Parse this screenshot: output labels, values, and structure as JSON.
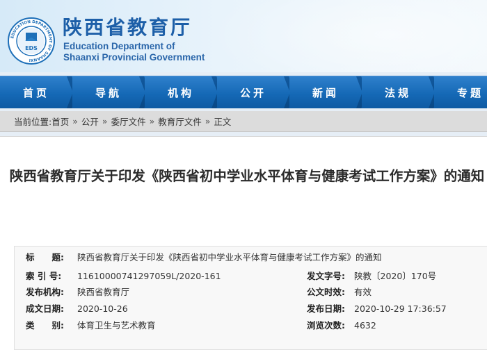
{
  "header": {
    "site_title": "陕西省教育厅",
    "site_en_line1": "Education Department of",
    "site_en_line2": "Shaanxi Provincial Government",
    "emblem_ring_text": "EDUCATION DEPARTMENT OF SHAANXI",
    "emblem_center_text": "EDS",
    "brand_color": "#1d5fa8"
  },
  "nav": {
    "items": [
      "首页",
      "导航",
      "机构",
      "公开",
      "新闻",
      "法规",
      "专题"
    ],
    "bg_color": "#1569b6"
  },
  "breadcrumb": {
    "prefix": "当前位置:",
    "items": [
      "首页",
      "公开",
      "委厅文件",
      "教育厅文件",
      "正文"
    ],
    "separator": "»"
  },
  "article": {
    "title": "陕西省教育厅关于印发《陕西省初中学业水平体育与健康考试工作方案》的通知"
  },
  "meta": {
    "title_label": "标　　题:",
    "title_value": "陕西省教育厅关于印发《陕西省初中学业水平体育与健康考试工作方案》的通知",
    "index_label": "索 引 号:",
    "index_value": "11610000741297059L/2020-161",
    "doc_no_label": "发文字号:",
    "doc_no_value": "陕教〔2020〕170号",
    "issuer_label": "发布机构:",
    "issuer_value": "陕西省教育厅",
    "validity_label": "公文时效:",
    "validity_value": "有效",
    "created_label": "成文日期:",
    "created_value": "2020-10-26",
    "published_label": "发布日期:",
    "published_value": "2020-10-29 17:36:57",
    "category_label": "类　　别:",
    "category_value": "体育卫生与艺术教育",
    "views_label": "浏览次数:",
    "views_value": "4632"
  }
}
